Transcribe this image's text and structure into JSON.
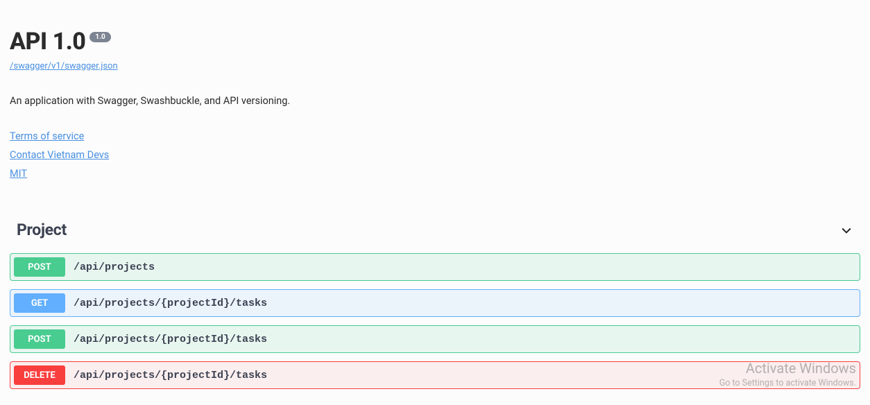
{
  "header": {
    "title": "API 1.0",
    "version_badge": "1.0",
    "spec_link": "/swagger/v1/swagger.json",
    "description": "An application with Swagger, Swashbuckle, and API versioning.",
    "links": {
      "terms": "Terms of service",
      "contact": "Contact Vietnam Devs",
      "license": "MIT"
    }
  },
  "section": {
    "title": "Project",
    "endpoints": [
      {
        "method": "POST",
        "path": "/api/projects"
      },
      {
        "method": "GET",
        "path": "/api/projects/{projectId}/tasks"
      },
      {
        "method": "POST",
        "path": "/api/projects/{projectId}/tasks"
      },
      {
        "method": "DELETE",
        "path": "/api/projects/{projectId}/tasks"
      }
    ]
  },
  "watermark": {
    "title": "Activate Windows",
    "sub": "Go to Settings to activate Windows."
  }
}
